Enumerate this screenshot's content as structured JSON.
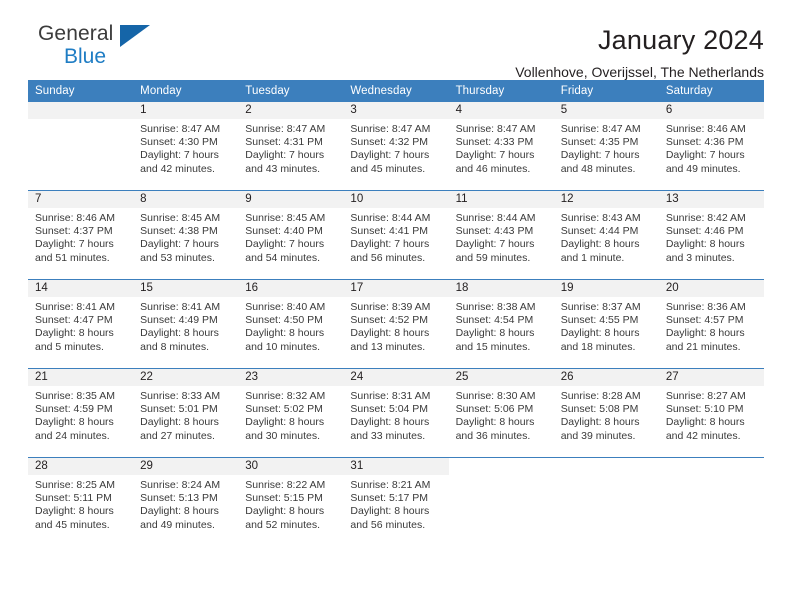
{
  "brand": {
    "line1": "General",
    "line2": "Blue",
    "accent_color": "#1f7dc4"
  },
  "header": {
    "title": "January 2024",
    "subtitle": "Vollenhove, Overijssel, The Netherlands"
  },
  "theme": {
    "header_blue": "#3c7fbd",
    "strip_gray": "#f2f2f2",
    "text": "#231f20"
  },
  "weekdays": [
    "Sunday",
    "Monday",
    "Tuesday",
    "Wednesday",
    "Thursday",
    "Friday",
    "Saturday"
  ],
  "weeks": [
    [
      {
        "day": "",
        "info": ""
      },
      {
        "day": "1",
        "info": "Sunrise: 8:47 AM\nSunset: 4:30 PM\nDaylight: 7 hours\nand 42 minutes."
      },
      {
        "day": "2",
        "info": "Sunrise: 8:47 AM\nSunset: 4:31 PM\nDaylight: 7 hours\nand 43 minutes."
      },
      {
        "day": "3",
        "info": "Sunrise: 8:47 AM\nSunset: 4:32 PM\nDaylight: 7 hours\nand 45 minutes."
      },
      {
        "day": "4",
        "info": "Sunrise: 8:47 AM\nSunset: 4:33 PM\nDaylight: 7 hours\nand 46 minutes."
      },
      {
        "day": "5",
        "info": "Sunrise: 8:47 AM\nSunset: 4:35 PM\nDaylight: 7 hours\nand 48 minutes."
      },
      {
        "day": "6",
        "info": "Sunrise: 8:46 AM\nSunset: 4:36 PM\nDaylight: 7 hours\nand 49 minutes."
      }
    ],
    [
      {
        "day": "7",
        "info": "Sunrise: 8:46 AM\nSunset: 4:37 PM\nDaylight: 7 hours\nand 51 minutes."
      },
      {
        "day": "8",
        "info": "Sunrise: 8:45 AM\nSunset: 4:38 PM\nDaylight: 7 hours\nand 53 minutes."
      },
      {
        "day": "9",
        "info": "Sunrise: 8:45 AM\nSunset: 4:40 PM\nDaylight: 7 hours\nand 54 minutes."
      },
      {
        "day": "10",
        "info": "Sunrise: 8:44 AM\nSunset: 4:41 PM\nDaylight: 7 hours\nand 56 minutes."
      },
      {
        "day": "11",
        "info": "Sunrise: 8:44 AM\nSunset: 4:43 PM\nDaylight: 7 hours\nand 59 minutes."
      },
      {
        "day": "12",
        "info": "Sunrise: 8:43 AM\nSunset: 4:44 PM\nDaylight: 8 hours\nand 1 minute."
      },
      {
        "day": "13",
        "info": "Sunrise: 8:42 AM\nSunset: 4:46 PM\nDaylight: 8 hours\nand 3 minutes."
      }
    ],
    [
      {
        "day": "14",
        "info": "Sunrise: 8:41 AM\nSunset: 4:47 PM\nDaylight: 8 hours\nand 5 minutes."
      },
      {
        "day": "15",
        "info": "Sunrise: 8:41 AM\nSunset: 4:49 PM\nDaylight: 8 hours\nand 8 minutes."
      },
      {
        "day": "16",
        "info": "Sunrise: 8:40 AM\nSunset: 4:50 PM\nDaylight: 8 hours\nand 10 minutes."
      },
      {
        "day": "17",
        "info": "Sunrise: 8:39 AM\nSunset: 4:52 PM\nDaylight: 8 hours\nand 13 minutes."
      },
      {
        "day": "18",
        "info": "Sunrise: 8:38 AM\nSunset: 4:54 PM\nDaylight: 8 hours\nand 15 minutes."
      },
      {
        "day": "19",
        "info": "Sunrise: 8:37 AM\nSunset: 4:55 PM\nDaylight: 8 hours\nand 18 minutes."
      },
      {
        "day": "20",
        "info": "Sunrise: 8:36 AM\nSunset: 4:57 PM\nDaylight: 8 hours\nand 21 minutes."
      }
    ],
    [
      {
        "day": "21",
        "info": "Sunrise: 8:35 AM\nSunset: 4:59 PM\nDaylight: 8 hours\nand 24 minutes."
      },
      {
        "day": "22",
        "info": "Sunrise: 8:33 AM\nSunset: 5:01 PM\nDaylight: 8 hours\nand 27 minutes."
      },
      {
        "day": "23",
        "info": "Sunrise: 8:32 AM\nSunset: 5:02 PM\nDaylight: 8 hours\nand 30 minutes."
      },
      {
        "day": "24",
        "info": "Sunrise: 8:31 AM\nSunset: 5:04 PM\nDaylight: 8 hours\nand 33 minutes."
      },
      {
        "day": "25",
        "info": "Sunrise: 8:30 AM\nSunset: 5:06 PM\nDaylight: 8 hours\nand 36 minutes."
      },
      {
        "day": "26",
        "info": "Sunrise: 8:28 AM\nSunset: 5:08 PM\nDaylight: 8 hours\nand 39 minutes."
      },
      {
        "day": "27",
        "info": "Sunrise: 8:27 AM\nSunset: 5:10 PM\nDaylight: 8 hours\nand 42 minutes."
      }
    ],
    [
      {
        "day": "28",
        "info": "Sunrise: 8:25 AM\nSunset: 5:11 PM\nDaylight: 8 hours\nand 45 minutes."
      },
      {
        "day": "29",
        "info": "Sunrise: 8:24 AM\nSunset: 5:13 PM\nDaylight: 8 hours\nand 49 minutes."
      },
      {
        "day": "30",
        "info": "Sunrise: 8:22 AM\nSunset: 5:15 PM\nDaylight: 8 hours\nand 52 minutes."
      },
      {
        "day": "31",
        "info": "Sunrise: 8:21 AM\nSunset: 5:17 PM\nDaylight: 8 hours\nand 56 minutes."
      },
      {
        "day": "",
        "info": ""
      },
      {
        "day": "",
        "info": ""
      },
      {
        "day": "",
        "info": ""
      }
    ]
  ]
}
